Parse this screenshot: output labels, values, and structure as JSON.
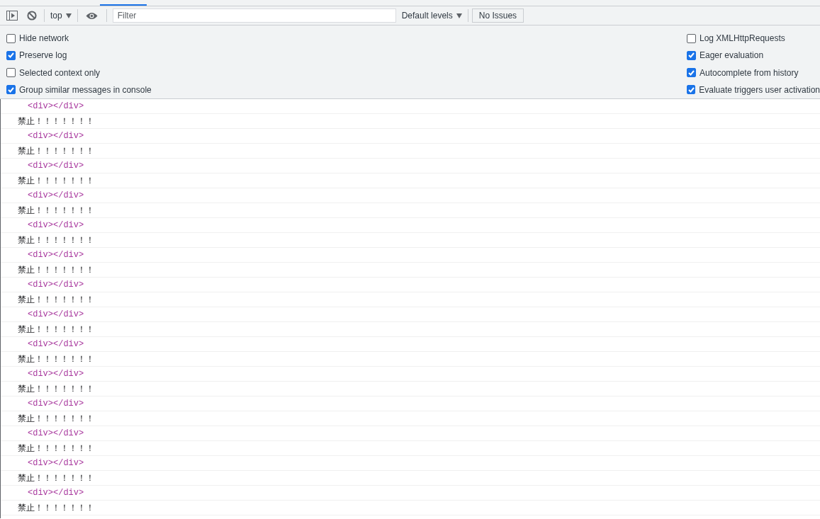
{
  "toolbar": {
    "context": "top",
    "filter": {
      "placeholder": "Filter"
    },
    "levels": "Default levels",
    "issues": "No Issues"
  },
  "settings": {
    "left": [
      {
        "label": "Hide network",
        "checked": false
      },
      {
        "label": "Preserve log",
        "checked": true
      },
      {
        "label": "Selected context only",
        "checked": false
      },
      {
        "label": "Group similar messages in console",
        "checked": true
      }
    ],
    "right": [
      {
        "label": "Log XMLHttpRequests",
        "checked": false
      },
      {
        "label": "Eager evaluation",
        "checked": true
      },
      {
        "label": "Autocomplete from history",
        "checked": true
      },
      {
        "label": "Evaluate triggers user activation",
        "checked": true
      }
    ]
  },
  "console": {
    "messages": [
      {
        "kind": "element",
        "text": "<div></div>"
      },
      {
        "kind": "log",
        "text": "禁止！！！！！！！"
      },
      {
        "kind": "element",
        "text": "<div></div>"
      },
      {
        "kind": "log",
        "text": "禁止！！！！！！！"
      },
      {
        "kind": "element",
        "text": "<div></div>"
      },
      {
        "kind": "log",
        "text": "禁止！！！！！！！"
      },
      {
        "kind": "element",
        "text": "<div></div>"
      },
      {
        "kind": "log",
        "text": "禁止！！！！！！！"
      },
      {
        "kind": "element",
        "text": "<div></div>"
      },
      {
        "kind": "log",
        "text": "禁止！！！！！！！"
      },
      {
        "kind": "element",
        "text": "<div></div>"
      },
      {
        "kind": "log",
        "text": "禁止！！！！！！！"
      },
      {
        "kind": "element",
        "text": "<div></div>"
      },
      {
        "kind": "log",
        "text": "禁止！！！！！！！"
      },
      {
        "kind": "element",
        "text": "<div></div>"
      },
      {
        "kind": "log",
        "text": "禁止！！！！！！！"
      },
      {
        "kind": "element",
        "text": "<div></div>"
      },
      {
        "kind": "log",
        "text": "禁止！！！！！！！"
      },
      {
        "kind": "element",
        "text": "<div></div>"
      },
      {
        "kind": "log",
        "text": "禁止！！！！！！！"
      },
      {
        "kind": "element",
        "text": "<div></div>"
      },
      {
        "kind": "log",
        "text": "禁止！！！！！！！"
      },
      {
        "kind": "element",
        "text": "<div></div>"
      },
      {
        "kind": "log",
        "text": "禁止！！！！！！！"
      },
      {
        "kind": "element",
        "text": "<div></div>"
      },
      {
        "kind": "log",
        "text": "禁止！！！！！！！"
      },
      {
        "kind": "element",
        "text": "<div></div>"
      },
      {
        "kind": "log",
        "text": "禁止！！！！！！！"
      }
    ]
  }
}
